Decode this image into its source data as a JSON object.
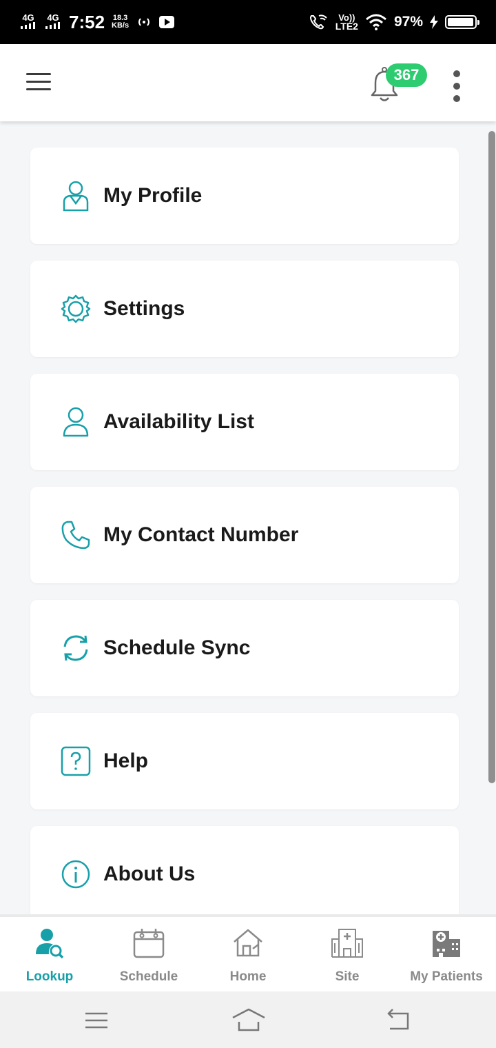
{
  "status_bar": {
    "sig1": "4G",
    "sig2": "4G",
    "time": "7:52",
    "speed_value": "18.3",
    "speed_unit": "KB/s",
    "volte": "Vo))",
    "lte": "LTE2",
    "battery": "97%",
    "battery_level": 0.97
  },
  "app_bar": {
    "notification_count": "367"
  },
  "menu": {
    "items": [
      {
        "label": "My Profile",
        "icon": "profile-icon"
      },
      {
        "label": "Settings",
        "icon": "gear-icon"
      },
      {
        "label": "Availability List",
        "icon": "user-icon"
      },
      {
        "label": "My Contact Number",
        "icon": "phone-icon"
      },
      {
        "label": "Schedule Sync",
        "icon": "sync-icon"
      },
      {
        "label": "Help",
        "icon": "help-icon"
      },
      {
        "label": "About Us",
        "icon": "info-icon"
      }
    ]
  },
  "bottom_nav": {
    "items": [
      {
        "label": "Lookup",
        "icon": "user-search-icon",
        "active": true
      },
      {
        "label": "Schedule",
        "icon": "calendar-icon",
        "active": false
      },
      {
        "label": "Home",
        "icon": "home-icon",
        "active": false
      },
      {
        "label": "Site",
        "icon": "hospital-icon",
        "active": false
      },
      {
        "label": "My Patients",
        "icon": "patients-icon",
        "active": false
      }
    ]
  },
  "colors": {
    "accent": "#18a0a9",
    "badge": "#2ecc71",
    "inactive": "#8a8a8a"
  }
}
